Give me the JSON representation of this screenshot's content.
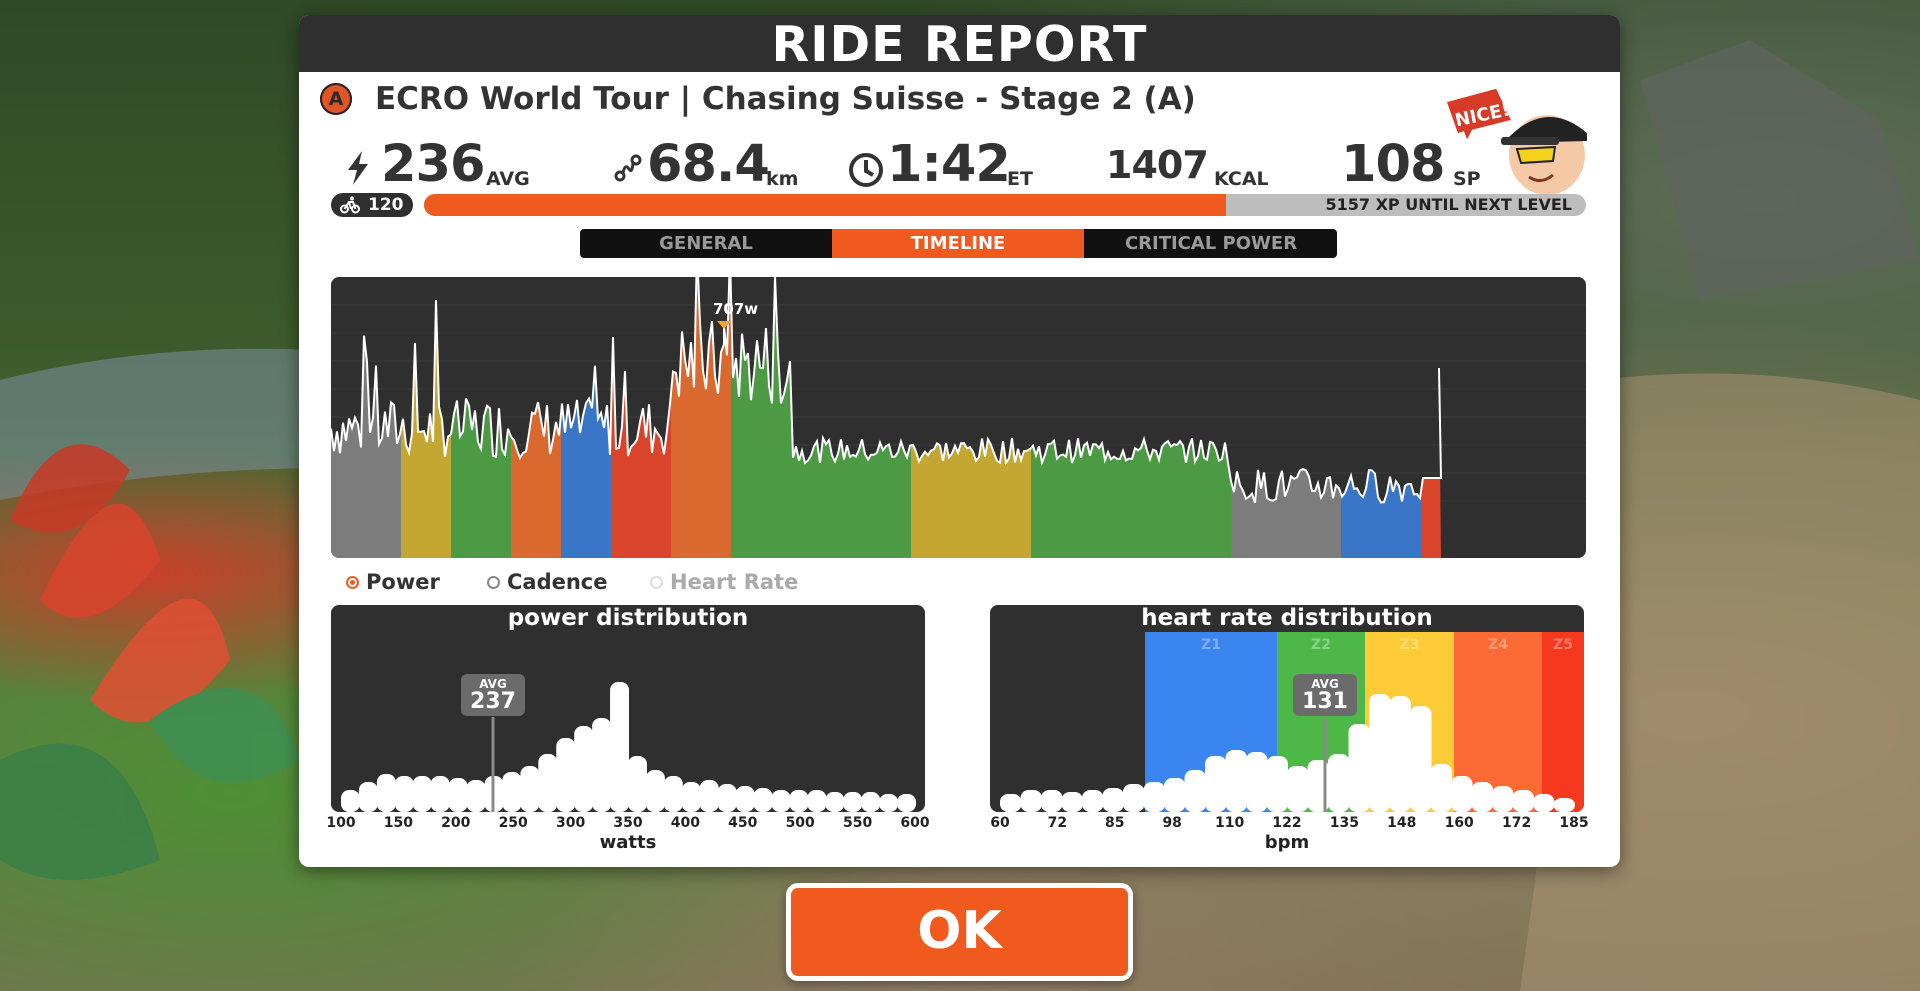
{
  "panel_title": "RIDE REPORT",
  "event": {
    "category": "A",
    "title": "ECRO World Tour | Chasing Suisse - Stage 2 (A)"
  },
  "stats": {
    "power": {
      "value": "236",
      "unit": "AVG",
      "icon": "lightning-icon"
    },
    "distance": {
      "value": "68.4",
      "unit": "km",
      "icon": "route-icon"
    },
    "time": {
      "value": "1:42",
      "unit": "ET",
      "icon": "clock-icon"
    },
    "calories": {
      "value": "1407",
      "unit": "KCAL"
    },
    "sport_points": {
      "value": "108",
      "unit": "SP"
    }
  },
  "mascot_bubble": "NICE!",
  "level": {
    "value": "120",
    "icon": "bike-icon"
  },
  "xp": {
    "text": "5157 XP UNTIL NEXT LEVEL",
    "progress": 0.69
  },
  "tabs": [
    {
      "label": "GENERAL",
      "active": false
    },
    {
      "label": "TIMELINE",
      "active": true
    },
    {
      "label": "CRITICAL POWER",
      "active": false
    }
  ],
  "timeline": {
    "peak_label": "707w"
  },
  "radio": {
    "power": "Power",
    "cadence": "Cadence",
    "heart_rate": "Heart Rate",
    "selected": "Power"
  },
  "power_distribution": {
    "title": "power distribution",
    "avg_label": "AVG",
    "avg_value": "237",
    "ticks": [
      "100",
      "150",
      "200",
      "250",
      "300",
      "350",
      "400",
      "450",
      "500",
      "550",
      "600"
    ],
    "xlabel": "watts"
  },
  "hr_distribution": {
    "title": "heart rate distribution",
    "avg_label": "AVG",
    "avg_value": "131",
    "ticks": [
      "60",
      "72",
      "85",
      "98",
      "110",
      "122",
      "135",
      "148",
      "160",
      "172",
      "185"
    ],
    "xlabel": "bpm",
    "zones": [
      "Z1",
      "Z2",
      "Z3",
      "Z4",
      "Z5"
    ],
    "zone_colors": [
      "#3a85f0",
      "#4db848",
      "#fccb35",
      "#fb6a34",
      "#f6381e"
    ]
  },
  "ok_label": "OK",
  "colors": {
    "accent": "#f05a1e",
    "panel_dark": "#2f2f2f",
    "zone_gray": "#7c7c7c",
    "zone_blue": "#3a76c8",
    "zone_green": "#4c9a43",
    "zone_yellow": "#c4a733",
    "zone_orange": "#d9692f",
    "zone_red": "#d9442a"
  }
}
